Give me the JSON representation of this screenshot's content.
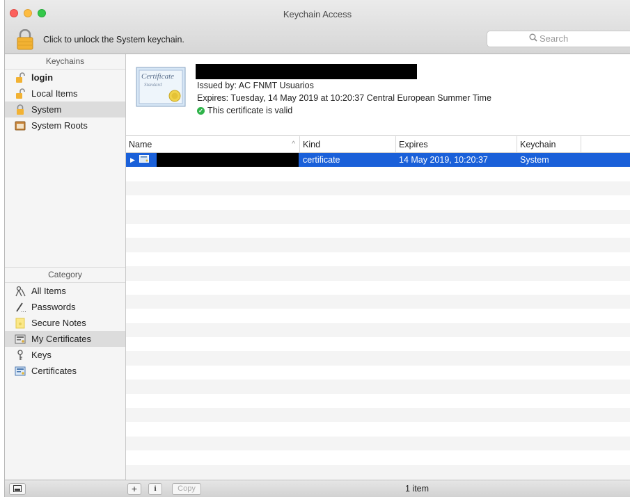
{
  "window": {
    "title": "Keychain Access"
  },
  "toolbar": {
    "lock_label": "Click to unlock the System keychain.",
    "search_placeholder": "Search"
  },
  "sidebar": {
    "keychains_header": "Keychains",
    "keychains": [
      {
        "label": "login",
        "icon": "unlocked-lock-icon",
        "bold": true
      },
      {
        "label": "Local Items",
        "icon": "unlocked-lock-icon"
      },
      {
        "label": "System",
        "icon": "locked-lock-icon",
        "selected": true
      },
      {
        "label": "System Roots",
        "icon": "cabinet-icon"
      }
    ],
    "category_header": "Category",
    "categories": [
      {
        "label": "All Items",
        "icon": "all-items-icon"
      },
      {
        "label": "Passwords",
        "icon": "password-pen-icon"
      },
      {
        "label": "Secure Notes",
        "icon": "secure-note-icon"
      },
      {
        "label": "My Certificates",
        "icon": "my-certificate-icon",
        "selected": true
      },
      {
        "label": "Keys",
        "icon": "key-icon"
      },
      {
        "label": "Certificates",
        "icon": "certificate-icon"
      }
    ]
  },
  "detail": {
    "issued_by": "Issued by: AC FNMT Usuarios",
    "expires": "Expires: Tuesday, 14 May 2019 at 10:20:37 Central European Summer Time",
    "validity": "This certificate is valid",
    "cert_icon_text": "Certificate",
    "cert_icon_subtext": "Standard"
  },
  "table": {
    "columns": {
      "name": "Name",
      "kind": "Kind",
      "expires": "Expires",
      "keychain": "Keychain"
    },
    "rows": [
      {
        "kind": "certificate",
        "expires": "14 May 2019, 10:20:37",
        "keychain": "System",
        "selected": true
      }
    ]
  },
  "statusbar": {
    "add_label": "+",
    "info_label": "i",
    "copy_label": "Copy",
    "count": "1 item"
  },
  "colors": {
    "selection": "#1a60d9",
    "valid": "#2fb34a",
    "lock": "#f2b233"
  }
}
